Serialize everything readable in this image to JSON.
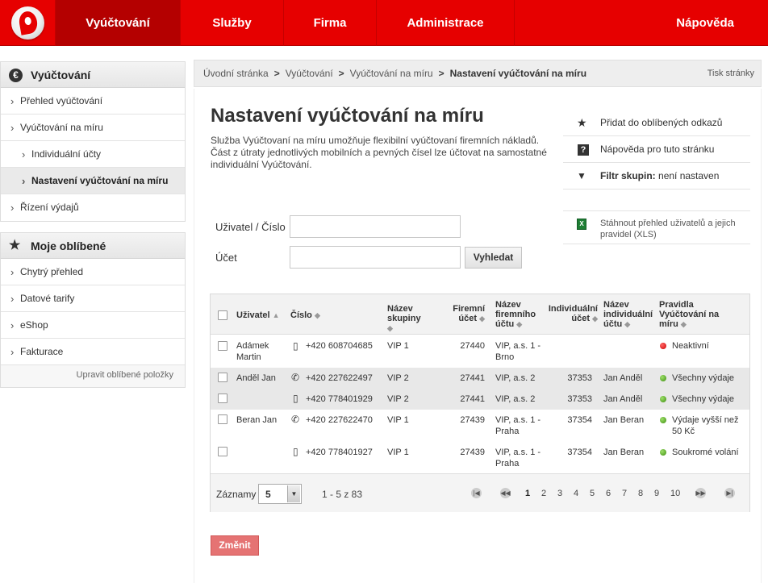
{
  "nav": {
    "items": [
      "Vyúčtování",
      "Služby",
      "Firma",
      "Administrace",
      "Nápověda"
    ]
  },
  "sidebar": {
    "billing_title": "Vyúčtování",
    "billing_items": [
      "Přehled vyúčtování",
      "Vyúčtování na míru",
      "Individuální účty",
      "Nastavení vyúčtování na míru",
      "Řízení výdajů"
    ],
    "favorites_title": "Moje oblíbené",
    "favorites_items": [
      "Chytrý přehled",
      "Datové tarify",
      "eShop",
      "Fakturace"
    ],
    "edit_link": "Upravit oblíbené položky"
  },
  "breadcrumb": {
    "items": [
      "Úvodní stránka",
      "Vyúčtování",
      "Vyúčtování na míru"
    ],
    "current": "Nastavení vyúčtování na míru",
    "separator": ">",
    "print": "Tisk stránky"
  },
  "page": {
    "title": "Nastavení vyúčtování na míru",
    "intro": "Služba Vyúčtovaní na míru umožňuje flexibilní vyúčtovaní firemních nákladů. Část z útraty jednotlivých mobilních a pevných čísel lze účtovat na samostatné individuální Vyúčtování."
  },
  "tools": {
    "favorite": "Přidat do oblíbených odkazů",
    "help": "Nápověda pro tuto stránku",
    "filter_label": "Filtr skupin:",
    "filter_value": "není nastaven",
    "download": "Stáhnout přehled uživatelů a jejich pravidel (XLS)"
  },
  "form": {
    "user_label": "Uživatel / Číslo",
    "user_value": "",
    "account_label": "Účet",
    "account_value": "",
    "search_button": "Vyhledat"
  },
  "table": {
    "headers": {
      "user": "Uživatel",
      "number": "Číslo",
      "group": "Název skupiny",
      "company_acc": "Firemní účet",
      "company_acc_name": "Název firemního účtu",
      "indiv_acc": "Individuální účet",
      "indiv_acc_name": "Název individuální účtu",
      "rules": "Pravidla Vyúčtování na míru"
    },
    "rows": [
      {
        "user": "Adámek Martin",
        "device": "mobile",
        "number": "+420 608704685",
        "group": "VIP 1",
        "company_acc": "27440",
        "company_acc_name": "VIP, a.s. 1 - Brno",
        "indiv_acc": "",
        "indiv_acc_name": "",
        "rule_status": "red",
        "rule": "Neaktivní"
      },
      {
        "user": "Anděl Jan",
        "device": "phone",
        "number": "+420 227622497",
        "group": "VIP 2",
        "company_acc": "27441",
        "company_acc_name": "VIP, a.s. 2",
        "indiv_acc": "37353",
        "indiv_acc_name": "Jan Anděl",
        "rule_status": "green",
        "rule": "Všechny výdaje"
      },
      {
        "user": "",
        "device": "mobile",
        "number": "+420 778401929",
        "group": "VIP 2",
        "company_acc": "27441",
        "company_acc_name": "VIP, a.s. 2",
        "indiv_acc": "37353",
        "indiv_acc_name": "Jan Anděl",
        "rule_status": "green",
        "rule": "Všechny výdaje"
      },
      {
        "user": "Beran Jan",
        "device": "phone",
        "number": "+420 227622470",
        "group": "VIP 1",
        "company_acc": "27439",
        "company_acc_name": "VIP, a.s. 1 - Praha",
        "indiv_acc": "37354",
        "indiv_acc_name": "Jan Beran",
        "rule_status": "green",
        "rule": "Výdaje vyšší než 50 Kč"
      },
      {
        "user": "",
        "device": "mobile",
        "number": "+420 778401927",
        "group": "VIP 1",
        "company_acc": "27439",
        "company_acc_name": "VIP, a.s. 1 - Praha",
        "indiv_acc": "37354",
        "indiv_acc_name": "Jan Beran",
        "rule_status": "green",
        "rule": "Soukromé volání"
      }
    ]
  },
  "pager": {
    "rows_label": "Záznamy",
    "rows_value": "5",
    "range": "1 - 5 z 83",
    "pages": [
      "1",
      "2",
      "3",
      "4",
      "5",
      "6",
      "7",
      "8",
      "9",
      "10"
    ],
    "current_page": "1"
  },
  "change_button": "Změnit",
  "colors": {
    "brand_red": "#e60000",
    "nav_active": "#b40000",
    "status_red": "#cc0000",
    "status_green": "#3c8d0e"
  }
}
